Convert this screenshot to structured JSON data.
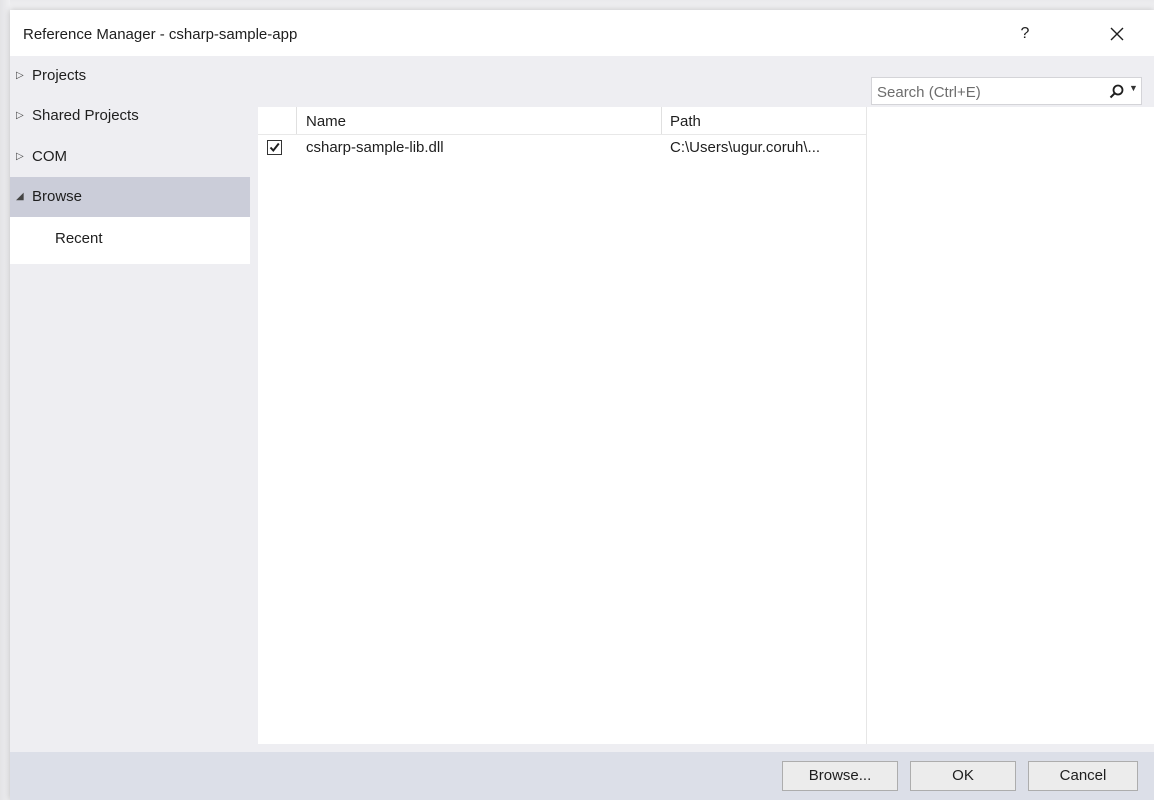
{
  "window": {
    "title": "Reference Manager - csharp-sample-app",
    "help_label": "?",
    "close_label": "✕"
  },
  "sidebar": {
    "items": [
      {
        "label": "Projects",
        "arrow": "▷",
        "expanded": false
      },
      {
        "label": "Shared Projects",
        "arrow": "▷",
        "expanded": false
      },
      {
        "label": "COM",
        "arrow": "▷",
        "expanded": false
      },
      {
        "label": "Browse",
        "arrow": "◢",
        "expanded": true,
        "selected": true
      }
    ],
    "sub_item": {
      "label": "Recent",
      "selected": true
    }
  },
  "search": {
    "placeholder": "Search (Ctrl+E)",
    "value": ""
  },
  "table": {
    "columns": [
      "Name",
      "Path"
    ],
    "rows": [
      {
        "checked": true,
        "name": "csharp-sample-lib.dll",
        "path": "C:\\Users\\ugur.coruh\\..."
      }
    ]
  },
  "footer": {
    "browse_label": "Browse...",
    "ok_label": "OK",
    "cancel_label": "Cancel"
  },
  "colors": {
    "selected_nav": "#cbcdd9",
    "body_bg": "#eeeef2",
    "footer_bg": "#dcdfe8"
  }
}
